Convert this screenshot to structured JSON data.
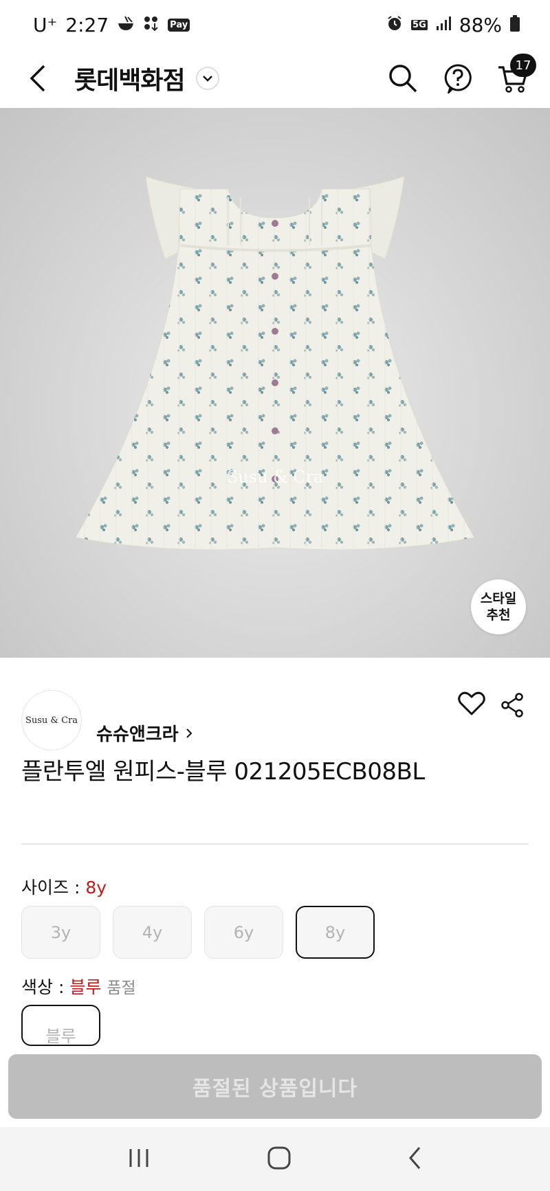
{
  "status_bar": {
    "carrier": "U⁺",
    "time": "2:27",
    "left_icons": [
      "bowl-icon",
      "dots-download-icon",
      "pay-icon"
    ],
    "pay_label": "Pay",
    "right_icons": [
      "alarm-icon",
      "5g-icon",
      "signal-icon",
      "battery-icon"
    ],
    "network": "5G",
    "battery": "88%"
  },
  "header": {
    "title": "롯데백화점",
    "cart_count": "17"
  },
  "product": {
    "watermark": "Susu & Cra",
    "style_rec_line1": "스타일",
    "style_rec_line2": "추천",
    "brand_logo_text": "Susu & Cra",
    "brand_name": "슈슈앤크라",
    "title": "플란투엘 원피스-블루 021205ECB08BL"
  },
  "options": {
    "size_label": "사이즈 : ",
    "size_selected": "8y",
    "sizes": [
      "3y",
      "4y",
      "6y",
      "8y"
    ],
    "color_label": "색상 : ",
    "color_selected": "블루",
    "color_status": "품절",
    "colors": [
      "블루"
    ]
  },
  "cta": {
    "label": "품절된 상품입니다"
  },
  "colors": {
    "accent_red": "#c21a1a",
    "soldout_bg": "#bdbdbd",
    "badge_bg": "#111111"
  }
}
